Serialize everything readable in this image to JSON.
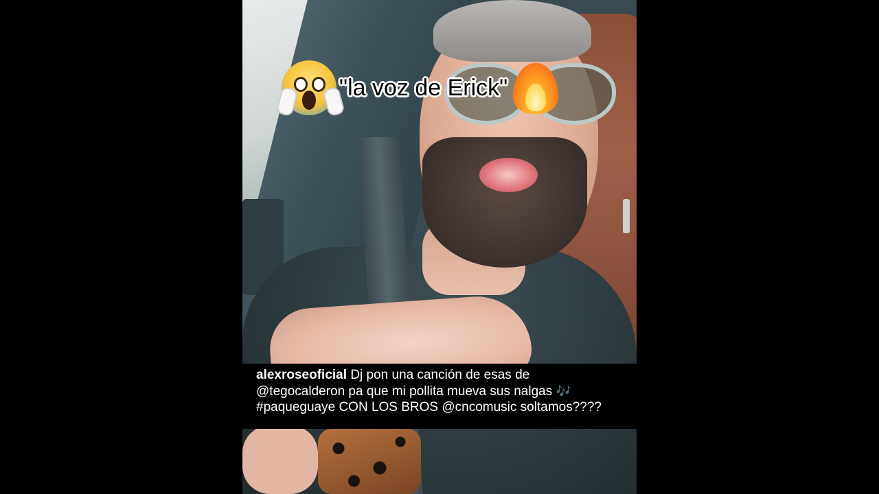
{
  "overlay": {
    "title_text": "\"la voz de Erick\"",
    "left_emoji": "face-screaming-in-fear",
    "right_emoji": "fire"
  },
  "caption": {
    "username": "alexroseoficial",
    "line1": "Dj pon una canción de esas de",
    "line2": "@tegocalderon pa que mi pollita mueva sus nalgas",
    "line2_emoji": "🎶",
    "line3": "#paqueguaye CON LOS BROS @cncomusic soltamos????"
  },
  "colors": {
    "letterbox": "#000000",
    "caption_bg": "#000000",
    "caption_text": "#ffffff",
    "title_text": "#000000",
    "title_outline": "#ffffff"
  }
}
